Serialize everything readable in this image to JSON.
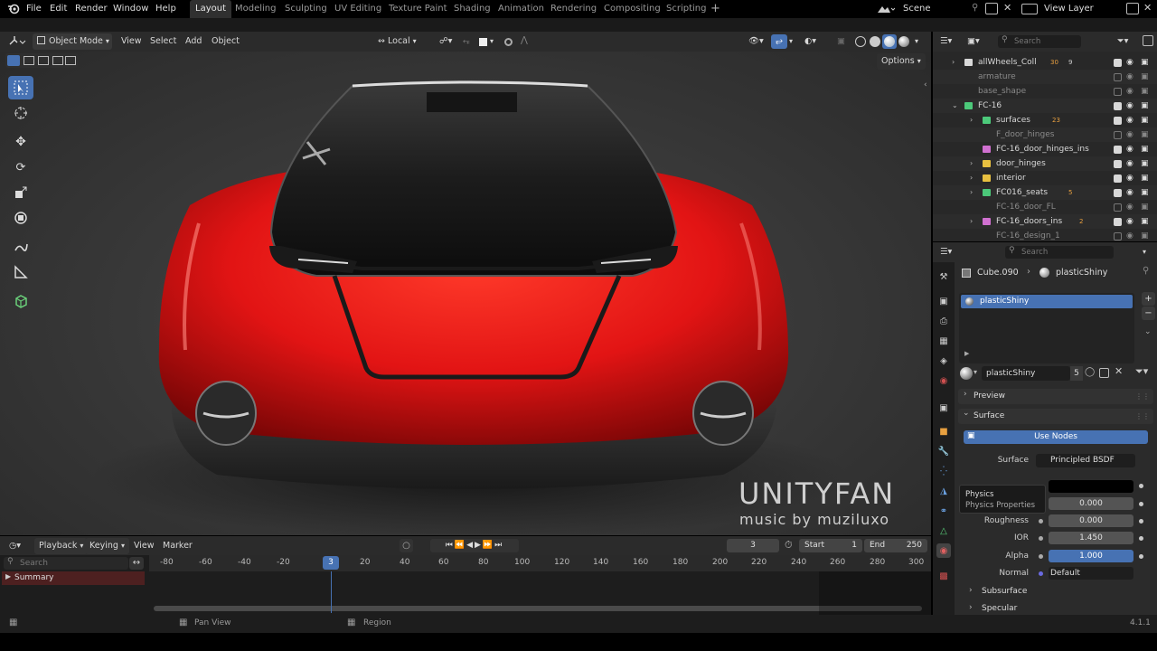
{
  "topbar": {
    "menus": [
      "File",
      "Edit",
      "Render",
      "Window",
      "Help"
    ],
    "workspaces": [
      "Layout",
      "Modeling",
      "Sculpting",
      "UV Editing",
      "Texture Paint",
      "Shading",
      "Animation",
      "Rendering",
      "Compositing",
      "Scripting"
    ],
    "add_tab": "+",
    "scene": "Scene",
    "view_layer": "View Layer"
  },
  "viewport_header": {
    "mode": "Object Mode",
    "menus": [
      "View",
      "Select",
      "Add",
      "Object"
    ],
    "transform": "Local",
    "options": "Options"
  },
  "viewport": {
    "watermark_title": "UNITYFAN",
    "watermark_sub": "music by muziluxo",
    "tooltip_title": "Physics",
    "tooltip_desc": "Physics Properties"
  },
  "timeline": {
    "menus": [
      "Playback",
      "Keying",
      "View",
      "Marker"
    ],
    "current_frame": "3",
    "start_label": "Start",
    "start": "1",
    "end_label": "End",
    "end": "250",
    "search_placeholder": "Search",
    "summary": "Summary",
    "ticks": [
      "-80",
      "-60",
      "-40",
      "-20",
      "3",
      "20",
      "40",
      "60",
      "80",
      "100",
      "120",
      "140",
      "160",
      "180",
      "200",
      "220",
      "240",
      "260",
      "280",
      "300"
    ]
  },
  "statusbar": {
    "pan": "Pan View",
    "region": "Region",
    "version": "4.1.1"
  },
  "outliner": {
    "search_placeholder": "Search",
    "rows": [
      {
        "label": "allWheels_Coll",
        "badge": "30",
        "badge2": "9",
        "color": "#d8d8d8",
        "icon": "collection-icon",
        "checked": true
      },
      {
        "label": "armature",
        "color": "#8a8a8a",
        "icon": "none",
        "checked": false
      },
      {
        "label": "base_shape",
        "color": "#8a8a8a",
        "icon": "none",
        "checked": false
      },
      {
        "label": "FC-16",
        "color": "#d8d8d8",
        "icon": "collection-green-icon",
        "checked": true
      },
      {
        "label": "surfaces",
        "badge": "23",
        "color": "#d8d8d8",
        "icon": "collection-green-icon",
        "checked": true
      },
      {
        "label": "F_door_hinges",
        "color": "#8a8a8a",
        "icon": "none",
        "checked": false
      },
      {
        "label": "FC-16_door_hinges_ins",
        "color": "#d8d8d8",
        "icon": "collection-pink-icon",
        "checked": true
      },
      {
        "label": "door_hinges",
        "color": "#d8d8d8",
        "icon": "collection-yellow-icon",
        "checked": true
      },
      {
        "label": "interior",
        "color": "#d8d8d8",
        "icon": "collection-yellow-icon",
        "checked": true
      },
      {
        "label": "FC016_seats",
        "badge": "5",
        "color": "#d8d8d8",
        "icon": "collection-green-icon",
        "checked": true
      },
      {
        "label": "FC-16_door_FL",
        "color": "#8a8a8a",
        "icon": "none",
        "checked": false
      },
      {
        "label": "FC-16_doors_ins",
        "badge": "2",
        "color": "#d8d8d8",
        "icon": "collection-pink-icon",
        "checked": true
      },
      {
        "label": "FC-16_design_1",
        "color": "#8a8a8a",
        "icon": "none",
        "checked": false
      }
    ]
  },
  "properties": {
    "search_placeholder": "Search",
    "object": "Cube.090",
    "material": "plasticShiny",
    "slot_selected": "plasticShiny",
    "material_field": "plasticShiny",
    "users": "5",
    "preview": "Preview",
    "surface_panel": "Surface",
    "use_nodes": "Use Nodes",
    "surface_label": "Surface",
    "surface_value": "Principled BSDF",
    "rows": [
      {
        "label": "",
        "value": "0.000"
      },
      {
        "label": "Roughness",
        "value": "0.000"
      },
      {
        "label": "IOR",
        "value": "1.450"
      },
      {
        "label": "Alpha",
        "value": "1.000"
      },
      {
        "label": "Normal",
        "value": "Default"
      }
    ],
    "subsurface": "Subsurface",
    "specular": "Specular"
  },
  "colors": {
    "accent": "#4772b3",
    "car_red": "#e01818",
    "active_tab": "#303030"
  }
}
